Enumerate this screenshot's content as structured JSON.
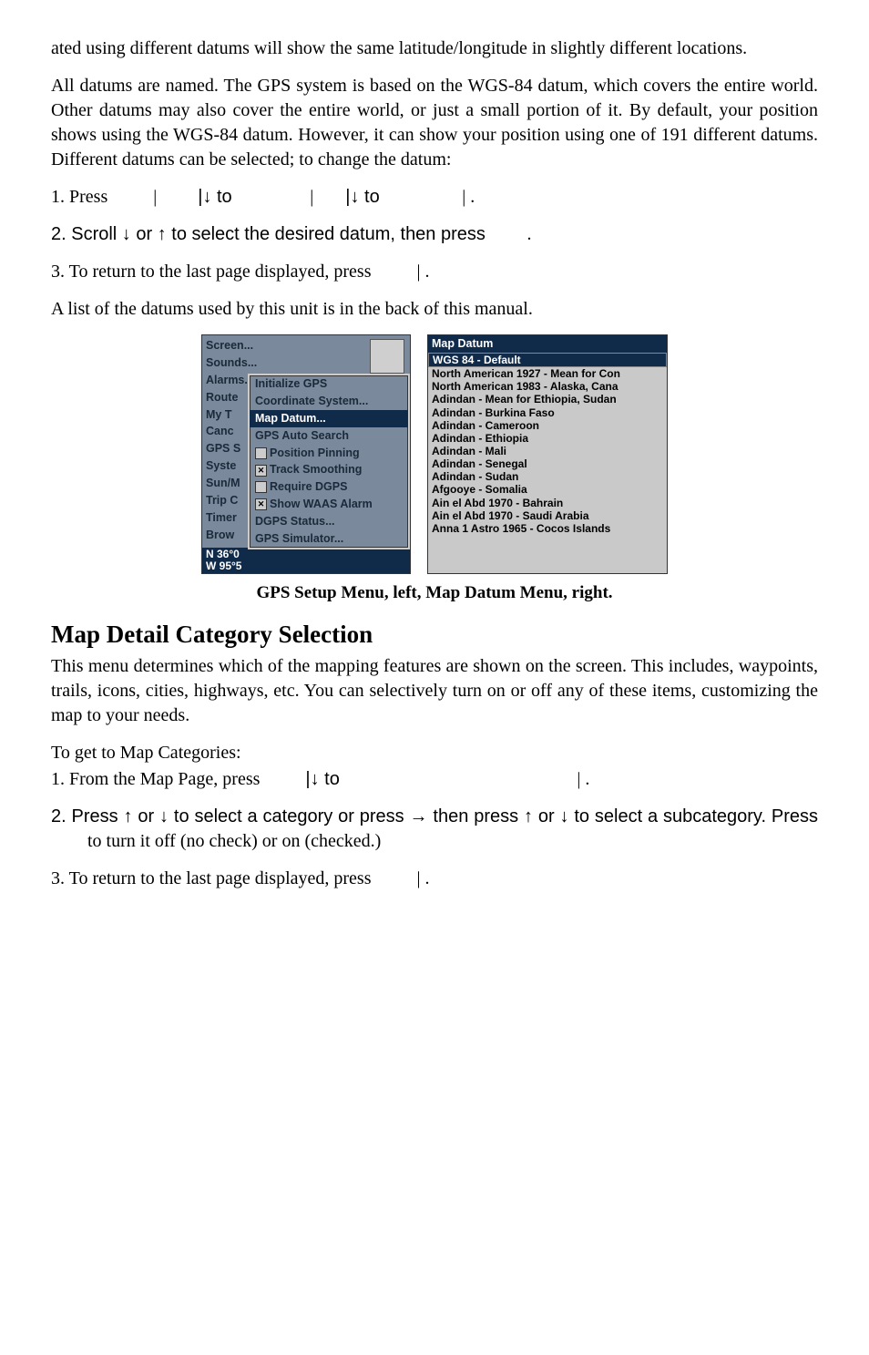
{
  "para1": "ated using different datums will show the same latitude/longitude in slightly different locations.",
  "para2": "All datums are named. The GPS system is based on the WGS-84 datum, which covers the entire world. Other datums may also cover the entire world, or just a small portion of it. By default, your position shows using the WGS-84 datum. However, it can show your position using one of 191 different datums. Different datums can be selected; to change the datum:",
  "step1_pre": "1. Press ",
  "step1_mid1": "|",
  "step1_to": "|↓ to ",
  "step1_mid2": "|",
  "step1_to2": "|↓ to ",
  "step1_end": "|     .",
  "step2": "2. Scroll ↓ or ↑ to select the desired datum, then press ",
  "step2_end": ".",
  "step3": "3. To return to the last page displayed, press ",
  "step3_end": "|      .",
  "para3": "A list of the datums used by this unit is in the back of this manual.",
  "caption": "GPS Setup Menu, left, Map Datum Menu, right.",
  "h2": "Map Detail Category Selection",
  "para4": "This menu determines which of the mapping features are shown on the screen. This includes, waypoints, trails, icons, cities, highways, etc. You can selectively turn on or off any of these items, customizing the map to your needs.",
  "para5": "To get to Map Categories:",
  "step1b_pre": "1. From the Map Page, press ",
  "step1b_to": "|↓ to ",
  "step1b_end": "|     .",
  "step2b": "2. Press ↑ or ↓ to select a category or press → then press ↑ or ↓ to select a subcategory. Press ",
  "step2b_mid": " to turn it off (no check) or on (checked.)",
  "step3b": "3. To return to the last page displayed, press ",
  "step3b_end": "|      .",
  "left_menu": {
    "back": [
      "Screen...",
      "Sounds...",
      "Alarms...",
      "Route",
      "My T",
      "Canc",
      "GPS S",
      "Syste",
      "Sun/M",
      "Trip C",
      "Timer",
      "Brow"
    ],
    "sub": [
      {
        "label": "Initialize GPS",
        "chk": null
      },
      {
        "label": "Coordinate System...",
        "chk": null
      },
      {
        "label": "Map Datum...",
        "chk": null,
        "sel": true
      },
      {
        "label": "GPS Auto Search",
        "chk": null
      },
      {
        "label": "Position Pinning",
        "chk": false
      },
      {
        "label": "Track Smoothing",
        "chk": true
      },
      {
        "label": "Require DGPS",
        "chk": false
      },
      {
        "label": "Show WAAS Alarm",
        "chk": true
      },
      {
        "label": "DGPS Status...",
        "chk": null
      },
      {
        "label": "GPS Simulator...",
        "chk": null
      }
    ],
    "status": [
      "N  36°0",
      "W  95°5"
    ]
  },
  "right_menu": {
    "title": "Map Datum",
    "items": [
      {
        "label": "WGS 84 - Default",
        "sel": true
      },
      {
        "label": "North American 1927 - Mean for Con"
      },
      {
        "label": "North American 1983 - Alaska, Cana"
      },
      {
        "label": "Adindan - Mean for Ethiopia, Sudan"
      },
      {
        "label": "Adindan - Burkina Faso"
      },
      {
        "label": "Adindan - Cameroon"
      },
      {
        "label": "Adindan - Ethiopia"
      },
      {
        "label": "Adindan - Mali"
      },
      {
        "label": "Adindan - Senegal"
      },
      {
        "label": "Adindan - Sudan"
      },
      {
        "label": "Afgooye - Somalia"
      },
      {
        "label": "Ain el Abd 1970 - Bahrain"
      },
      {
        "label": "Ain el Abd 1970 - Saudi Arabia"
      },
      {
        "label": "Anna 1 Astro 1965 - Cocos Islands"
      }
    ]
  }
}
